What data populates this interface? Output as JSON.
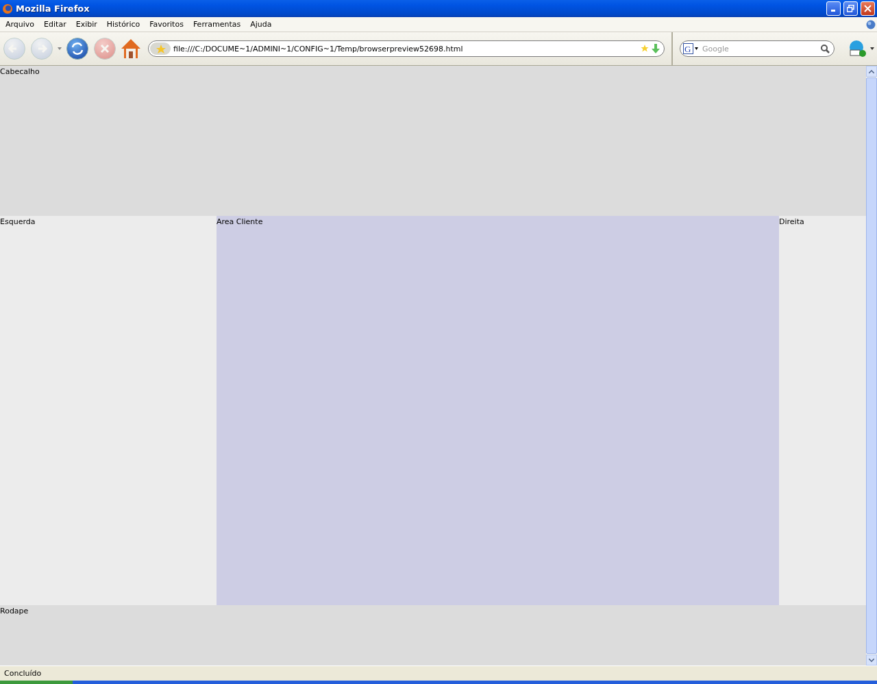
{
  "window": {
    "title": "Mozilla Firefox"
  },
  "menu": [
    {
      "label": "Arquivo"
    },
    {
      "label": "Editar"
    },
    {
      "label": "Exibir"
    },
    {
      "label": "Histórico"
    },
    {
      "label": "Favoritos"
    },
    {
      "label": "Ferramentas"
    },
    {
      "label": "Ajuda"
    }
  ],
  "toolbar": {
    "back_disabled": true,
    "forward_disabled": true,
    "stop_disabled": true,
    "address": "file:///C:/DOCUME~1/ADMINI~1/CONFIG~1/Temp/browserpreview52698.html",
    "search_engine_letter": "G",
    "search_placeholder": "Google"
  },
  "page": {
    "header": "Cabecalho",
    "left": "Esquerda",
    "center": "Area Cliente",
    "right": "Direita",
    "footer": "Rodape"
  },
  "status_bar": "Concluído"
}
